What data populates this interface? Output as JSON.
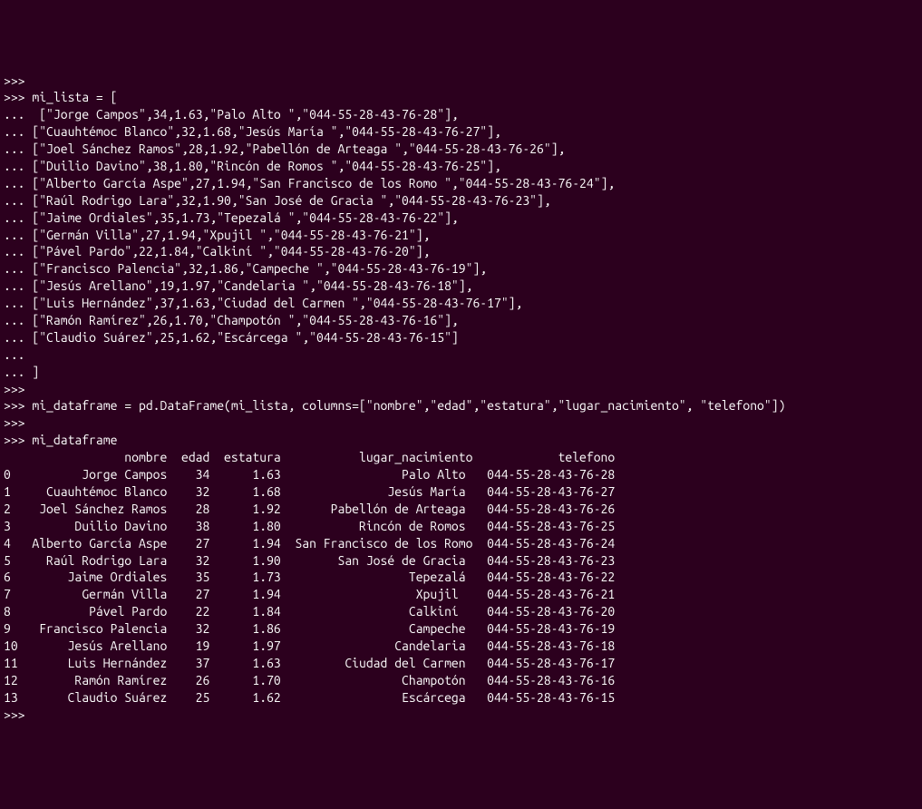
{
  "prompt": ">>>",
  "continuation": "...",
  "commands": {
    "listDecl": "mi_lista = [",
    "listRows": [
      " [\"Jorge Campos\",34,1.63,\"Palo Alto \",\"044-55-28-43-76-28\"],",
      "[\"Cuauhtémoc Blanco\",32,1.68,\"Jesús María \",\"044-55-28-43-76-27\"],",
      "[\"Joel Sánchez Ramos\",28,1.92,\"Pabellón de Arteaga \",\"044-55-28-43-76-26\"],",
      "[\"Duilio Davino\",38,1.80,\"Rincón de Romos \",\"044-55-28-43-76-25\"],",
      "[\"Alberto García Aspe\",27,1.94,\"San Francisco de los Romo \",\"044-55-28-43-76-24\"],",
      "[\"Raúl Rodrigo Lara\",32,1.90,\"San José de Gracia \",\"044-55-28-43-76-23\"],",
      "[\"Jaime Ordiales\",35,1.73,\"Tepezalá \",\"044-55-28-43-76-22\"],",
      "[\"Germán Villa\",27,1.94,\"Xpujil \",\"044-55-28-43-76-21\"],",
      "[\"Pável Pardo\",22,1.84,\"Calkiní \",\"044-55-28-43-76-20\"],",
      "[\"Francisco Palencia\",32,1.86,\"Campeche \",\"044-55-28-43-76-19\"],",
      "[\"Jesús Arellano\",19,1.97,\"Candelaria \",\"044-55-28-43-76-18\"],",
      "[\"Luis Hernández\",37,1.63,\"Ciudad del Carmen \",\"044-55-28-43-76-17\"],",
      "[\"Ramón Ramírez\",26,1.70,\"Champotón \",\"044-55-28-43-76-16\"],",
      "[\"Claudio Suárez\",25,1.62,\"Escárcega \",\"044-55-28-43-76-15\"]"
    ],
    "listClose": "]",
    "dfCreate": "mi_dataframe = pd.DataFrame(mi_lista, columns=[\"nombre\",\"edad\",\"estatura\",\"lugar_nacimiento\", \"telefono\"])",
    "dfShow": "mi_dataframe"
  },
  "output": {
    "header": "                 nombre  edad  estatura           lugar_nacimiento            telefono",
    "rows": [
      "0          Jorge Campos    34      1.63                 Palo Alto   044-55-28-43-76-28",
      "1     Cuauhtémoc Blanco    32      1.68               Jesús María   044-55-28-43-76-27",
      "2    Joel Sánchez Ramos    28      1.92       Pabellón de Arteaga   044-55-28-43-76-26",
      "3         Duilio Davino    38      1.80           Rincón de Romos   044-55-28-43-76-25",
      "4   Alberto García Aspe    27      1.94  San Francisco de los Romo  044-55-28-43-76-24",
      "5     Raúl Rodrigo Lara    32      1.90        San José de Gracia   044-55-28-43-76-23",
      "6        Jaime Ordiales    35      1.73                  Tepezalá   044-55-28-43-76-22",
      "7          Germán Villa    27      1.94                   Xpujil    044-55-28-43-76-21",
      "8           Pável Pardo    22      1.84                  Calkiní    044-55-28-43-76-20",
      "9    Francisco Palencia    32      1.86                  Campeche   044-55-28-43-76-19",
      "10       Jesús Arellano    19      1.97                Candelaria   044-55-28-43-76-18",
      "11       Luis Hernández    37      1.63         Ciudad del Carmen   044-55-28-43-76-17",
      "12        Ramón Ramírez    26      1.70                 Champotón   044-55-28-43-76-16",
      "13       Claudio Suárez    25      1.62                 Escárcega   044-55-28-43-76-15"
    ]
  }
}
